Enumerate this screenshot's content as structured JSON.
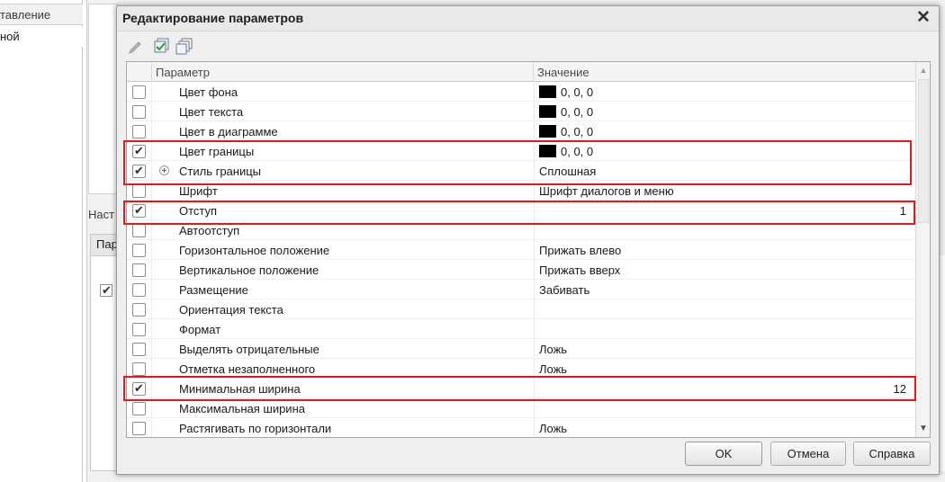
{
  "background": {
    "left_header": "тавление",
    "left_row": "ной",
    "settings_label": "Наст",
    "tab_label": "Пар"
  },
  "dialog": {
    "title": "Редактирование параметров",
    "close_glyph": "✕",
    "toolbar": [
      {
        "name": "edit-icon"
      },
      {
        "name": "check-all-icon"
      },
      {
        "name": "uncheck-all-icon"
      }
    ],
    "columns": {
      "parameter": "Параметр",
      "value": "Значение"
    },
    "rows": [
      {
        "name": "Цвет фона",
        "checked": false,
        "value": "0, 0, 0",
        "swatch": "#000000"
      },
      {
        "name": "Цвет текста",
        "checked": false,
        "value": "0, 0, 0",
        "swatch": "#000000"
      },
      {
        "name": "Цвет в диаграмме",
        "checked": false,
        "value": "0, 0, 0",
        "swatch": "#000000"
      },
      {
        "name": "Цвет границы",
        "checked": true,
        "value": "0, 0, 0",
        "swatch": "#000000"
      },
      {
        "name": "Стиль границы",
        "checked": true,
        "value": "Сплошная",
        "expandable": true
      },
      {
        "name": "Шрифт",
        "checked": false,
        "value": "Шрифт диалогов и меню"
      },
      {
        "name": "Отступ",
        "checked": true,
        "value": "1",
        "numeric": true
      },
      {
        "name": "Автоотступ",
        "checked": false,
        "value": ""
      },
      {
        "name": "Горизонтальное положение",
        "checked": false,
        "value": "Прижать влево"
      },
      {
        "name": "Вертикальное положение",
        "checked": false,
        "value": "Прижать вверх"
      },
      {
        "name": "Размещение",
        "checked": false,
        "value": "Забивать"
      },
      {
        "name": "Ориентация текста",
        "checked": false,
        "value": ""
      },
      {
        "name": "Формат",
        "checked": false,
        "value": ""
      },
      {
        "name": "Выделять отрицательные",
        "checked": false,
        "value": "Ложь"
      },
      {
        "name": "Отметка незаполненного",
        "checked": false,
        "value": "Ложь"
      },
      {
        "name": "Минимальная ширина",
        "checked": true,
        "value": "12",
        "numeric": true
      },
      {
        "name": "Максимальная ширина",
        "checked": false,
        "value": ""
      },
      {
        "name": "Растягивать по горизонтали",
        "checked": false,
        "value": "Ложь"
      }
    ],
    "buttons": {
      "ok": "OK",
      "cancel": "Отмена",
      "help": "Справка"
    },
    "highlight_color": "#e0191b"
  }
}
